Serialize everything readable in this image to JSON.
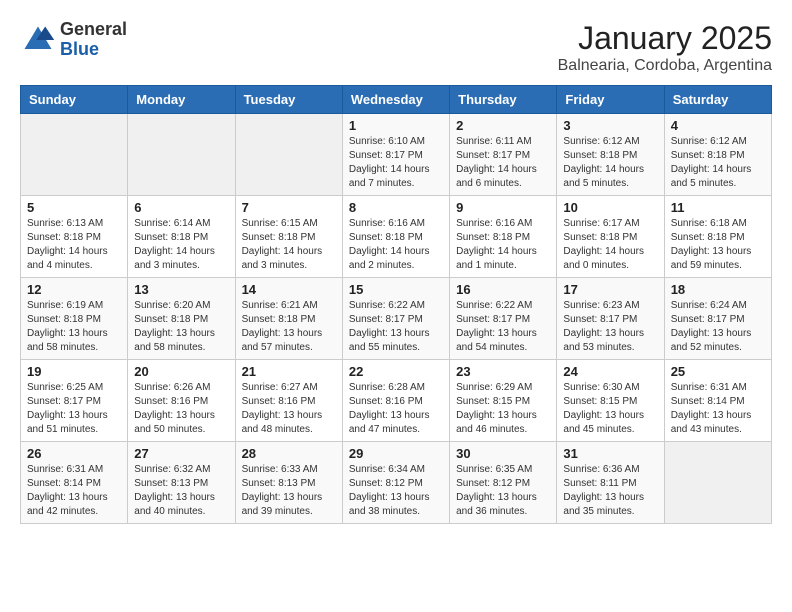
{
  "header": {
    "logo": {
      "general": "General",
      "blue": "Blue"
    },
    "title": "January 2025",
    "subtitle": "Balnearia, Cordoba, Argentina"
  },
  "calendar": {
    "weekdays": [
      "Sunday",
      "Monday",
      "Tuesday",
      "Wednesday",
      "Thursday",
      "Friday",
      "Saturday"
    ],
    "weeks": [
      [
        {
          "day": "",
          "info": ""
        },
        {
          "day": "",
          "info": ""
        },
        {
          "day": "",
          "info": ""
        },
        {
          "day": "1",
          "info": "Sunrise: 6:10 AM\nSunset: 8:17 PM\nDaylight: 14 hours\nand 7 minutes."
        },
        {
          "day": "2",
          "info": "Sunrise: 6:11 AM\nSunset: 8:17 PM\nDaylight: 14 hours\nand 6 minutes."
        },
        {
          "day": "3",
          "info": "Sunrise: 6:12 AM\nSunset: 8:18 PM\nDaylight: 14 hours\nand 5 minutes."
        },
        {
          "day": "4",
          "info": "Sunrise: 6:12 AM\nSunset: 8:18 PM\nDaylight: 14 hours\nand 5 minutes."
        }
      ],
      [
        {
          "day": "5",
          "info": "Sunrise: 6:13 AM\nSunset: 8:18 PM\nDaylight: 14 hours\nand 4 minutes."
        },
        {
          "day": "6",
          "info": "Sunrise: 6:14 AM\nSunset: 8:18 PM\nDaylight: 14 hours\nand 3 minutes."
        },
        {
          "day": "7",
          "info": "Sunrise: 6:15 AM\nSunset: 8:18 PM\nDaylight: 14 hours\nand 3 minutes."
        },
        {
          "day": "8",
          "info": "Sunrise: 6:16 AM\nSunset: 8:18 PM\nDaylight: 14 hours\nand 2 minutes."
        },
        {
          "day": "9",
          "info": "Sunrise: 6:16 AM\nSunset: 8:18 PM\nDaylight: 14 hours\nand 1 minute."
        },
        {
          "day": "10",
          "info": "Sunrise: 6:17 AM\nSunset: 8:18 PM\nDaylight: 14 hours\nand 0 minutes."
        },
        {
          "day": "11",
          "info": "Sunrise: 6:18 AM\nSunset: 8:18 PM\nDaylight: 13 hours\nand 59 minutes."
        }
      ],
      [
        {
          "day": "12",
          "info": "Sunrise: 6:19 AM\nSunset: 8:18 PM\nDaylight: 13 hours\nand 58 minutes."
        },
        {
          "day": "13",
          "info": "Sunrise: 6:20 AM\nSunset: 8:18 PM\nDaylight: 13 hours\nand 58 minutes."
        },
        {
          "day": "14",
          "info": "Sunrise: 6:21 AM\nSunset: 8:18 PM\nDaylight: 13 hours\nand 57 minutes."
        },
        {
          "day": "15",
          "info": "Sunrise: 6:22 AM\nSunset: 8:17 PM\nDaylight: 13 hours\nand 55 minutes."
        },
        {
          "day": "16",
          "info": "Sunrise: 6:22 AM\nSunset: 8:17 PM\nDaylight: 13 hours\nand 54 minutes."
        },
        {
          "day": "17",
          "info": "Sunrise: 6:23 AM\nSunset: 8:17 PM\nDaylight: 13 hours\nand 53 minutes."
        },
        {
          "day": "18",
          "info": "Sunrise: 6:24 AM\nSunset: 8:17 PM\nDaylight: 13 hours\nand 52 minutes."
        }
      ],
      [
        {
          "day": "19",
          "info": "Sunrise: 6:25 AM\nSunset: 8:17 PM\nDaylight: 13 hours\nand 51 minutes."
        },
        {
          "day": "20",
          "info": "Sunrise: 6:26 AM\nSunset: 8:16 PM\nDaylight: 13 hours\nand 50 minutes."
        },
        {
          "day": "21",
          "info": "Sunrise: 6:27 AM\nSunset: 8:16 PM\nDaylight: 13 hours\nand 48 minutes."
        },
        {
          "day": "22",
          "info": "Sunrise: 6:28 AM\nSunset: 8:16 PM\nDaylight: 13 hours\nand 47 minutes."
        },
        {
          "day": "23",
          "info": "Sunrise: 6:29 AM\nSunset: 8:15 PM\nDaylight: 13 hours\nand 46 minutes."
        },
        {
          "day": "24",
          "info": "Sunrise: 6:30 AM\nSunset: 8:15 PM\nDaylight: 13 hours\nand 45 minutes."
        },
        {
          "day": "25",
          "info": "Sunrise: 6:31 AM\nSunset: 8:14 PM\nDaylight: 13 hours\nand 43 minutes."
        }
      ],
      [
        {
          "day": "26",
          "info": "Sunrise: 6:31 AM\nSunset: 8:14 PM\nDaylight: 13 hours\nand 42 minutes."
        },
        {
          "day": "27",
          "info": "Sunrise: 6:32 AM\nSunset: 8:13 PM\nDaylight: 13 hours\nand 40 minutes."
        },
        {
          "day": "28",
          "info": "Sunrise: 6:33 AM\nSunset: 8:13 PM\nDaylight: 13 hours\nand 39 minutes."
        },
        {
          "day": "29",
          "info": "Sunrise: 6:34 AM\nSunset: 8:12 PM\nDaylight: 13 hours\nand 38 minutes."
        },
        {
          "day": "30",
          "info": "Sunrise: 6:35 AM\nSunset: 8:12 PM\nDaylight: 13 hours\nand 36 minutes."
        },
        {
          "day": "31",
          "info": "Sunrise: 6:36 AM\nSunset: 8:11 PM\nDaylight: 13 hours\nand 35 minutes."
        },
        {
          "day": "",
          "info": ""
        }
      ]
    ]
  }
}
